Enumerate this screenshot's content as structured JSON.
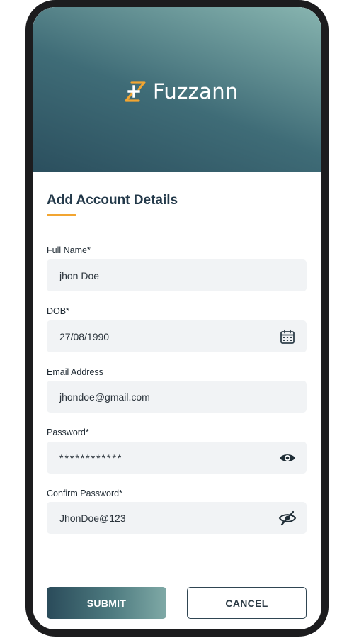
{
  "brand": {
    "name": "Fuzzann",
    "accent_color": "#f2a531",
    "header_gradient": [
      "#2b4f5e",
      "#88b5b0"
    ]
  },
  "form": {
    "title": "Add Account Details",
    "fields": {
      "full_name": {
        "label": "Full Name*",
        "value": "jhon Doe"
      },
      "dob": {
        "label": "DOB*",
        "value": "27/08/1990",
        "icon": "calendar-icon"
      },
      "email": {
        "label": "Email Address",
        "value": "jhondoe@gmail.com"
      },
      "password": {
        "label": "Password*",
        "value": "************",
        "icon": "eye-icon"
      },
      "confirm_password": {
        "label": "Confirm Password*",
        "value": "JhonDoe@123",
        "icon": "eye-off-icon"
      }
    }
  },
  "actions": {
    "submit_label": "SUBMIT",
    "cancel_label": "CANCEL"
  }
}
